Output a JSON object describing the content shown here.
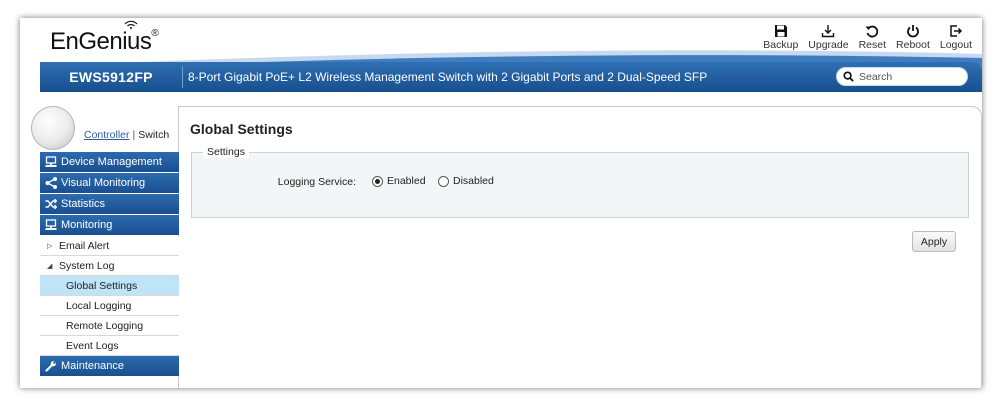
{
  "brand": {
    "name": "EnGenius",
    "reg": "®"
  },
  "toolbar": [
    {
      "id": "backup",
      "label": "Backup",
      "icon": "save-icon"
    },
    {
      "id": "upgrade",
      "label": "Upgrade",
      "icon": "download-icon"
    },
    {
      "id": "reset",
      "label": "Reset",
      "icon": "reset-icon"
    },
    {
      "id": "reboot",
      "label": "Reboot",
      "icon": "power-icon"
    },
    {
      "id": "logout",
      "label": "Logout",
      "icon": "logout-icon"
    }
  ],
  "titlebar": {
    "model": "EWS5912FP",
    "product": "8-Port Gigabit PoE+ L2 Wireless Management Switch with 2 Gigabit Ports and 2 Dual-Speed SFP",
    "search_placeholder": "Search"
  },
  "device_toggle": {
    "controller": "Controller",
    "separator": "|",
    "switch": "Switch"
  },
  "sidebar": {
    "device_management": "Device Management",
    "visual_monitoring": "Visual Monitoring",
    "statistics": "Statistics",
    "monitoring": "Monitoring",
    "email_alert": "Email Alert",
    "system_log": "System Log",
    "global_settings": "Global Settings",
    "local_logging": "Local Logging",
    "remote_logging": "Remote Logging",
    "event_logs": "Event Logs",
    "maintenance": "Maintenance"
  },
  "main": {
    "title": "Global Settings",
    "section": "Settings",
    "logging_label": "Logging Service:",
    "enabled": "Enabled",
    "disabled": "Disabled",
    "logging_value": "Enabled",
    "apply": "Apply"
  },
  "colors": {
    "accent": "#1f5d9f",
    "selected": "#bfe3f7"
  }
}
